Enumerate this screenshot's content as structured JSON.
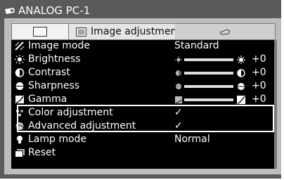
{
  "window": {
    "title": "ANALOG PC-1"
  },
  "tabs": {
    "active_label": "Image adjustment"
  },
  "menu": {
    "items": [
      {
        "label": "Image mode",
        "value": "Standard"
      },
      {
        "label": "Brightness",
        "value": "+0",
        "level": 0.5
      },
      {
        "label": "Contrast",
        "value": "+0",
        "level": 0.5
      },
      {
        "label": "Sharpness",
        "value": "+0",
        "level": 0.5
      },
      {
        "label": "Gamma",
        "value": "+0",
        "level": 0.5
      },
      {
        "label": "Color adjustment",
        "value": "✓"
      },
      {
        "label": "Advanced adjustment",
        "value": "✓"
      },
      {
        "label": "Lamp mode",
        "value": "Normal"
      },
      {
        "label": "Reset",
        "value": ""
      }
    ]
  },
  "colors": {
    "background": "#5a5a5a",
    "panel": "#bdbdbd",
    "list": "#000000",
    "text": "#ffffff"
  },
  "icons": [
    "projector-icon",
    "image-mode-icon",
    "brightness-icon",
    "contrast-icon",
    "sharpness-icon",
    "gamma-icon",
    "color-adjust-icon",
    "advanced-adjust-icon",
    "lamp-icon",
    "reset-icon"
  ]
}
